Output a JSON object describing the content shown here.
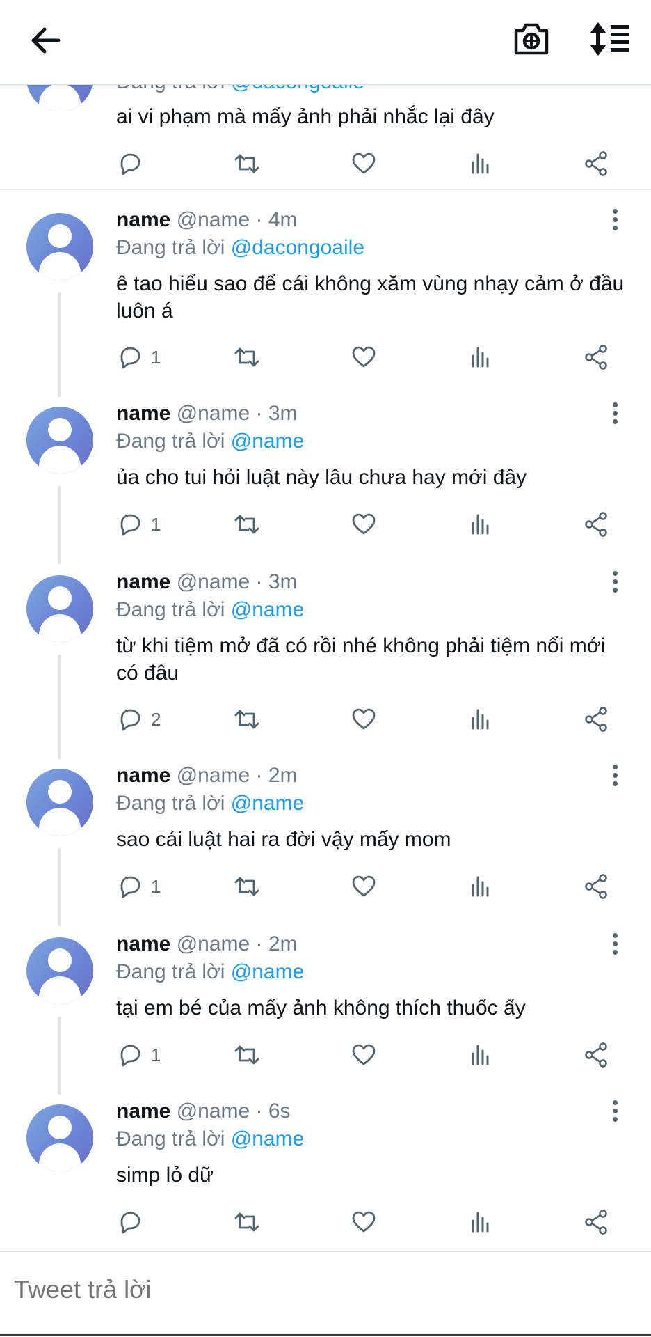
{
  "topbar": {
    "back_icon": "arrow-left-icon",
    "camera_icon": "camera-plus-icon",
    "sort_icon": "sort-list-icon"
  },
  "partial_tweet": {
    "reply_prefix": "Đang trả lời",
    "mention": "@dacongoaile",
    "text": "ai vi phạm mà mấy ảnh phải nhắc lại đây",
    "reply_count": ""
  },
  "tweets": [
    {
      "name": "name",
      "handle": "@name · 4m",
      "reply_prefix": "Đang trả lời",
      "mention": "@dacongoaile",
      "text": "ê tao hiểu sao để cái không xăm vùng nhạy cảm ở đầu luôn á",
      "reply_count": "1"
    },
    {
      "name": "name",
      "handle": "@name · 3m",
      "reply_prefix": "Đang trả lời",
      "mention": "@name",
      "text": "ủa cho tui hỏi luật này lâu chưa hay mới đây",
      "reply_count": "1"
    },
    {
      "name": "name",
      "handle": "@name · 3m",
      "reply_prefix": "Đang trả lời",
      "mention": "@name",
      "text": "từ khi tiệm mở đã có rồi nhé không phải tiệm nổi mới có đâu",
      "reply_count": "2"
    },
    {
      "name": "name",
      "handle": "@name · 2m",
      "reply_prefix": "Đang trả lời",
      "mention": "@name",
      "text": "sao cái luật hai ra đời vậy mấy mom",
      "reply_count": "1"
    },
    {
      "name": "name",
      "handle": "@name · 2m",
      "reply_prefix": "Đang trả lời",
      "mention": "@name",
      "text": "tại em bé của mấy ảnh không thích thuốc ấy",
      "reply_count": "1"
    },
    {
      "name": "name",
      "handle": "@name · 6s",
      "reply_prefix": "Đang trả lời",
      "mention": "@name",
      "text": "simp lỏ dữ",
      "reply_count": ""
    }
  ],
  "composer": {
    "placeholder": "Tweet trả lời"
  },
  "colors": {
    "mention": "#1d9bf0",
    "secondary_text": "#6b7a86",
    "icon": "#536471",
    "avatar_gradient": [
      "#7fa6df",
      "#6a6fc9"
    ]
  }
}
